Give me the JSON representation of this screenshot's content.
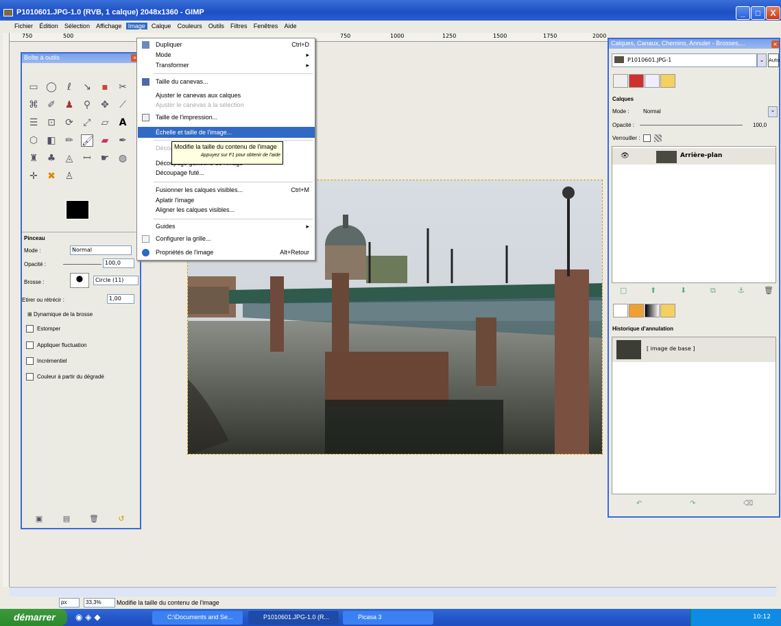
{
  "window": {
    "title": "P1010601.JPG-1.0 (RVB, 1 calque) 2048x1360 - GIMP",
    "btn_min": "_",
    "btn_max": "□",
    "btn_close": "X"
  },
  "menubar": [
    "Fichier",
    "Édition",
    "Sélection",
    "Affichage",
    "Image",
    "Calque",
    "Couleurs",
    "Outils",
    "Filtres",
    "Fenêtres",
    "Aide"
  ],
  "ruler": {
    "marks": [
      "750",
      "500",
      "750",
      "1000",
      "1250",
      "1500",
      "1750",
      "2000"
    ]
  },
  "toolbox": {
    "title": "Boîte à outils",
    "options_title": "Pinceau",
    "mode_label": "Mode :",
    "mode_value": "Normal",
    "opacity_label": "Opacité :",
    "opacity_value": "100,0",
    "brush_label": "Brosse :",
    "brush_value": "Circle (11)",
    "scale_label": "Etirer ou rétrécir :",
    "scale_value": "1,00",
    "dynamics_label": "Dynamique de la brosse",
    "checkboxes": [
      "Estomper",
      "Appliquer fluctuation",
      "Incrémentiel",
      "Couleur à partir du dégradé"
    ]
  },
  "image_menu": {
    "items": [
      {
        "label": "Dupliquer",
        "shortcut": "Ctrl+D"
      },
      {
        "label": "Mode",
        "shortcut": "▸"
      },
      {
        "label": "Transformer",
        "shortcut": "▸"
      },
      {
        "label": "Taille du canevas...",
        "shortcut": ""
      },
      {
        "label": "Ajuster le canevas aux calques",
        "shortcut": ""
      },
      {
        "label": "Ajuster le canevas à la sélection",
        "shortcut": ""
      },
      {
        "label": "Taille de l'impression...",
        "shortcut": ""
      },
      {
        "label": "Échelle et taille de l'image...",
        "shortcut": ""
      },
      {
        "label": "Découper",
        "shortcut": ""
      },
      {
        "label": "Découpage guillotine de l'image",
        "shortcut": ""
      },
      {
        "label": "Découpage futé...",
        "shortcut": ""
      },
      {
        "label": "Fusionner les calques visibles...",
        "shortcut": "Ctrl+M"
      },
      {
        "label": "Aplatir l'image",
        "shortcut": ""
      },
      {
        "label": "Aligner les calques visibles...",
        "shortcut": ""
      },
      {
        "label": "Guides",
        "shortcut": "▸"
      },
      {
        "label": "Configurer la grille...",
        "shortcut": ""
      },
      {
        "label": "Propriétés de l'image",
        "shortcut": "Alt+Retour"
      }
    ]
  },
  "tooltip": {
    "main": "Modifie la taille du contenu de l'image",
    "hint": "Appuyez sur F1 pour obtenir de l'aide"
  },
  "dock": {
    "title": "Calques, Canaux, Chemins, Annuler - Brosses,...",
    "image_select": "P1010601.JPG-1",
    "auto_button": "Auto",
    "layers_title": "Calques",
    "mode_label": "Mode :",
    "mode_value": "Normal",
    "opacity_label": "Opacité :",
    "opacity_value": "100,0",
    "lock_label": "Verrouiller :",
    "layer_name": "Arrière-plan",
    "history_title": "Historique d'annulation",
    "history_item": "[ image de base ]"
  },
  "statusbar": {
    "unit": "px",
    "zoom": "33,3%",
    "message": "Modifie la taille du contenu de l'image"
  },
  "taskbar": {
    "start": "démarrer",
    "tasks": [
      "C:\\Documents and Se...",
      "P1010601.JPG-1.0 (R...",
      "Picasa 3"
    ],
    "clock": "10:12"
  }
}
